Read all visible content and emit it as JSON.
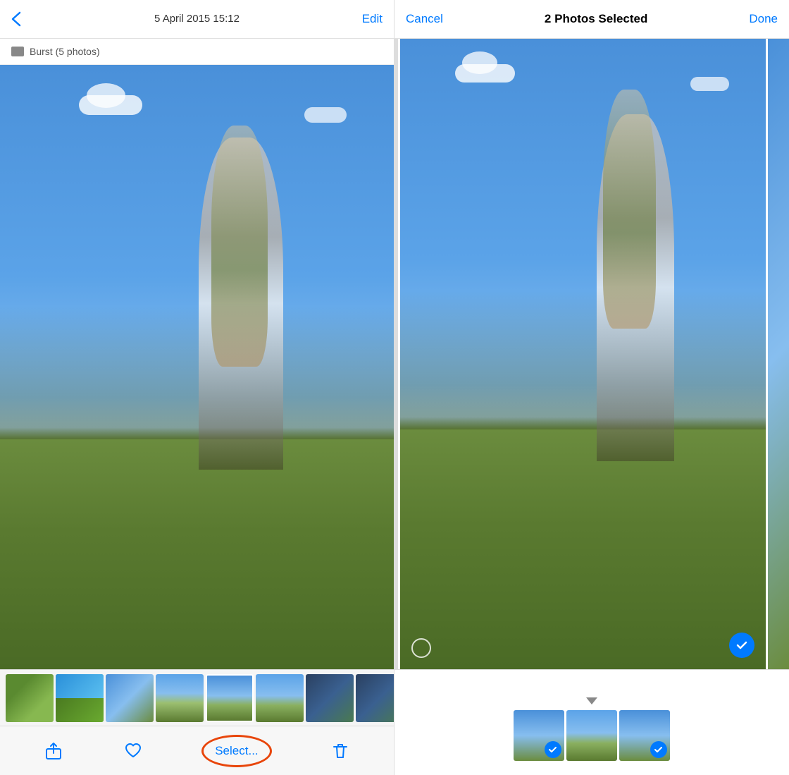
{
  "left_panel": {
    "header": {
      "back_label": "‹",
      "date_text": "5 April 2015  15:12",
      "edit_label": "Edit"
    },
    "burst_label": "Burst (5 photos)",
    "toolbar": {
      "share_label": "",
      "heart_label": "",
      "select_label": "Select...",
      "trash_label": ""
    },
    "thumbnails": [
      {
        "color": "green",
        "id": "thumb-1"
      },
      {
        "color": "teal",
        "id": "thumb-2"
      },
      {
        "color": "blue",
        "id": "thumb-3"
      },
      {
        "color": "action1",
        "id": "thumb-4"
      },
      {
        "color": "action2",
        "id": "thumb-5"
      },
      {
        "color": "action3",
        "id": "thumb-6"
      },
      {
        "color": "dark",
        "id": "thumb-7"
      },
      {
        "color": "dark",
        "id": "thumb-8"
      },
      {
        "color": "park",
        "id": "thumb-9"
      }
    ]
  },
  "right_panel": {
    "header": {
      "cancel_label": "Cancel",
      "title": "2 Photos Selected",
      "done_label": "Done"
    },
    "right_thumbnails": [
      {
        "color": "action1",
        "selected": true
      },
      {
        "color": "action2",
        "selected": false
      },
      {
        "color": "action3",
        "selected": true
      }
    ]
  },
  "colors": {
    "blue": "#007aff",
    "red_oval": "#e8450a"
  }
}
